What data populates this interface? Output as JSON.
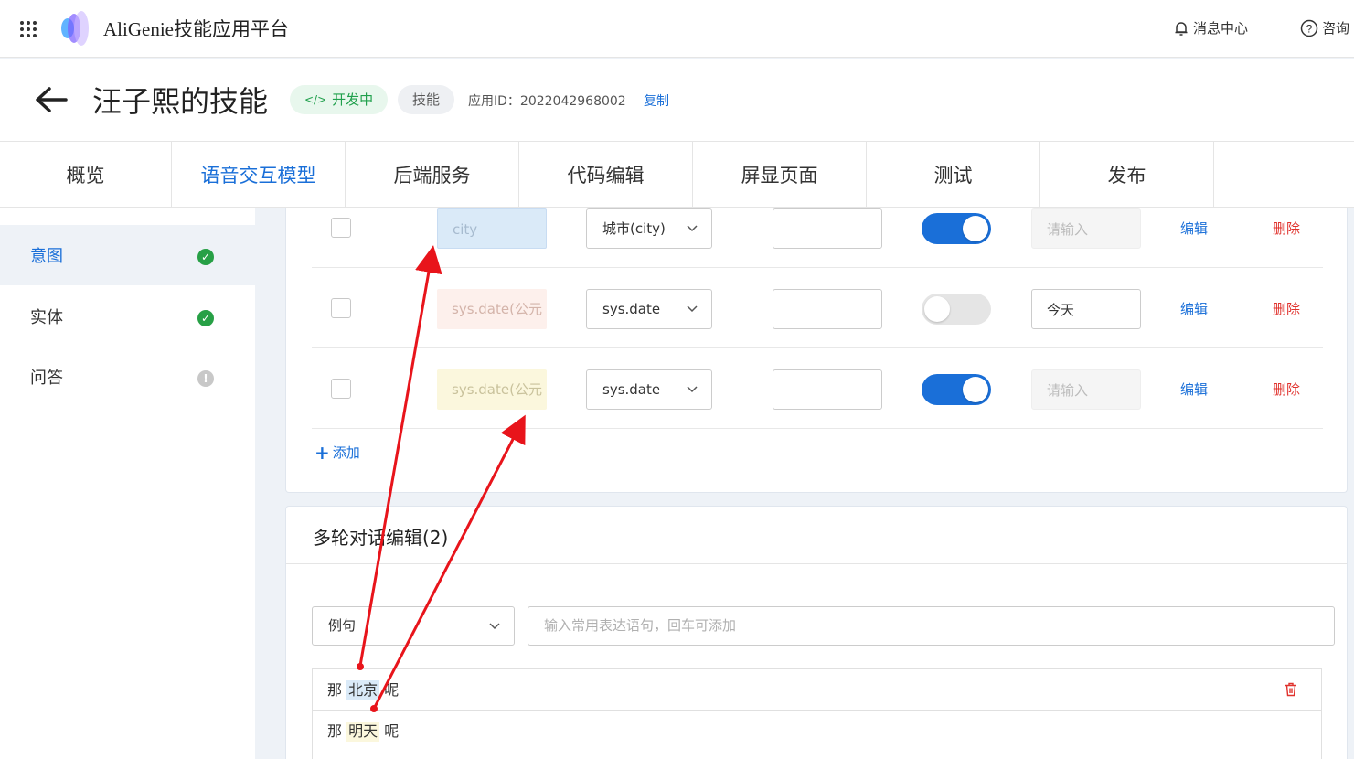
{
  "topbar": {
    "app_title": "AliGenie技能应用平台",
    "message_center": "消息中心",
    "consult": "咨询"
  },
  "header": {
    "skill_title": "汪子熙的技能",
    "status_badge": "开发中",
    "type_badge": "技能",
    "app_id_label": "应用ID：2022042968002",
    "copy_label": "复制"
  },
  "tabs": [
    {
      "label": "概览"
    },
    {
      "label": "语音交互模型",
      "active": true
    },
    {
      "label": "后端服务"
    },
    {
      "label": "代码编辑"
    },
    {
      "label": "屏显页面"
    },
    {
      "label": "测试"
    },
    {
      "label": "发布"
    }
  ],
  "sidebar": {
    "items": [
      {
        "label": "意图",
        "status": "ok",
        "active": true
      },
      {
        "label": "实体",
        "status": "ok"
      },
      {
        "label": "问答",
        "status": "warn"
      }
    ]
  },
  "slots": {
    "rows": [
      {
        "name": "city",
        "entity": "城市(city)",
        "required": true,
        "prompt_placeholder": "请输入",
        "prompt_value": "",
        "edit": "编辑",
        "delete": "删除"
      },
      {
        "name": "sys.date(公元",
        "entity": "sys.date",
        "required": false,
        "prompt_placeholder": "",
        "prompt_value": "今天",
        "edit": "编辑",
        "delete": "删除"
      },
      {
        "name": "sys.date(公元",
        "entity": "sys.date",
        "required": true,
        "prompt_placeholder": "请输入",
        "prompt_value": "",
        "edit": "编辑",
        "delete": "删除"
      }
    ],
    "add_label": "添加"
  },
  "dialog": {
    "title": "多轮对话编辑(2)",
    "example_select": "例句",
    "example_input_placeholder": "输入常用表达语句，回车可添加",
    "examples": [
      {
        "prefix": "那",
        "slot": "北京",
        "suffix": "呢"
      },
      {
        "prefix": "那",
        "slot": "明天",
        "suffix": "呢"
      }
    ]
  },
  "colors": {
    "accent": "#1a6fd8",
    "success": "#27a046",
    "danger": "#e0322d",
    "annotation": "#e8141b"
  }
}
